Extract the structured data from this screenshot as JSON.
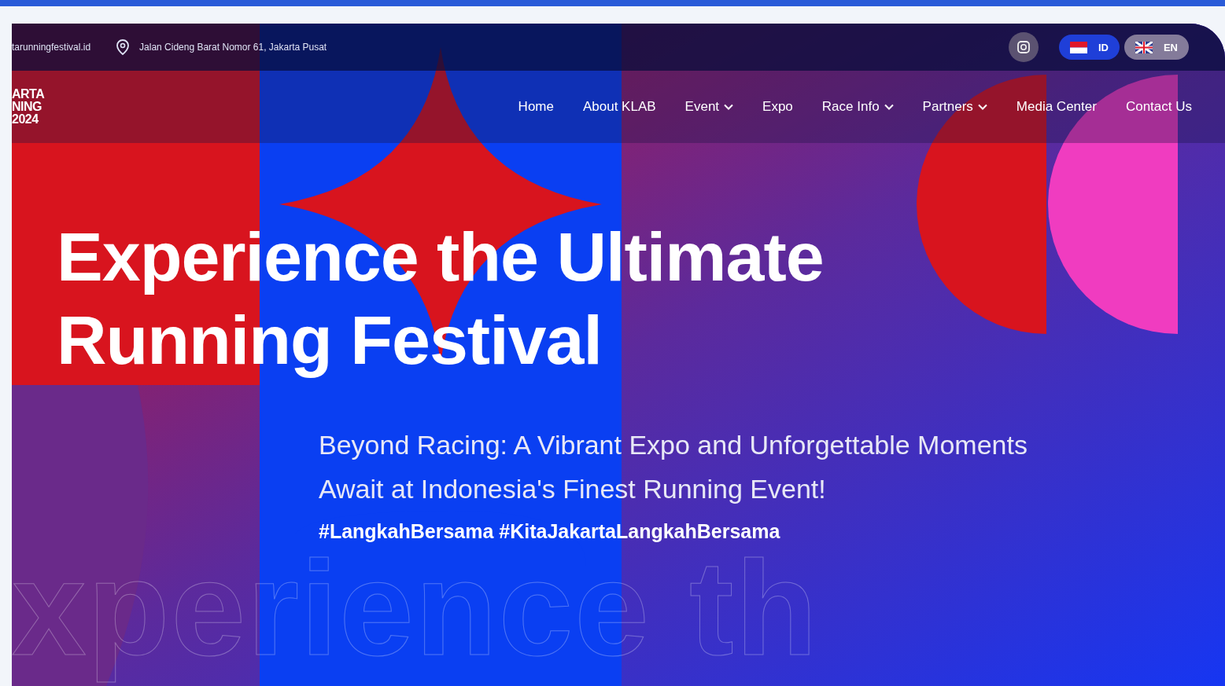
{
  "top_bar": {
    "website": "tarunningfestival.id",
    "address": "Jalan Cideng Barat Nomor 61, Jakarta Pusat",
    "languages": [
      {
        "code": "ID",
        "selected": true
      },
      {
        "code": "EN",
        "selected": false
      }
    ]
  },
  "logo": {
    "lines": [
      "ARTA",
      "NING",
      "2024"
    ]
  },
  "nav": [
    {
      "label": "Home",
      "dropdown": false
    },
    {
      "label": "About KLAB",
      "dropdown": false
    },
    {
      "label": "Event",
      "dropdown": true
    },
    {
      "label": "Expo",
      "dropdown": false
    },
    {
      "label": "Race Info",
      "dropdown": true
    },
    {
      "label": "Partners",
      "dropdown": true
    },
    {
      "label": "Media Center",
      "dropdown": false
    },
    {
      "label": "Contact Us",
      "dropdown": false
    }
  ],
  "hero": {
    "title_lines": [
      "Experience the Ultimate",
      "Running Festival"
    ],
    "subtitle": "Beyond Racing: A Vibrant Expo and Unforgettable Moments Await at Indonesia's Finest Running Event!",
    "hashtags": "#LangkahBersama #KitaJakartaLangkahBersama",
    "backdrop_text": "xperience th"
  }
}
